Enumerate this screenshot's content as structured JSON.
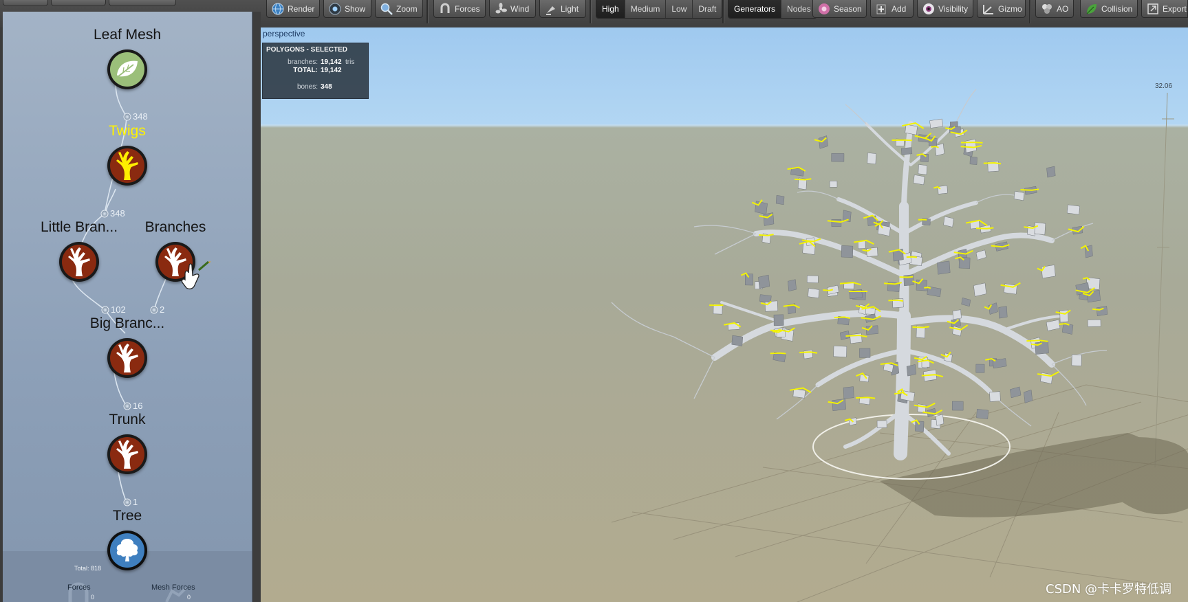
{
  "toolbar": {
    "buttons": [
      {
        "id": "render",
        "label": "Render",
        "icon": "globe-icon"
      },
      {
        "id": "show",
        "label": "Show",
        "icon": "eye-icon"
      },
      {
        "id": "zoom",
        "label": "Zoom",
        "icon": "magnifier-icon"
      },
      {
        "id": "forces",
        "label": "Forces",
        "icon": "magnet-icon"
      },
      {
        "id": "wind",
        "label": "Wind",
        "icon": "fan-icon"
      },
      {
        "id": "light",
        "label": "Light",
        "icon": "lamp-icon"
      }
    ],
    "quality": {
      "options": [
        "High",
        "Medium",
        "Low",
        "Draft"
      ],
      "selected": "High"
    },
    "mode": {
      "options": [
        "Generators",
        "Nodes"
      ],
      "selected": "Generators"
    },
    "buttons2": [
      {
        "id": "season",
        "label": "Season",
        "icon": "season-icon"
      },
      {
        "id": "add",
        "label": "Add",
        "icon": "add-icon"
      },
      {
        "id": "visibility",
        "label": "Visibility",
        "icon": "eyeball-icon"
      },
      {
        "id": "gizmo",
        "label": "Gizmo",
        "icon": "gizmo-icon"
      },
      {
        "id": "ao",
        "label": "AO",
        "icon": "ao-icon"
      },
      {
        "id": "collision",
        "label": "Collision",
        "icon": "leaf-collision-icon"
      },
      {
        "id": "export",
        "label": "Export",
        "icon": "export-icon"
      }
    ]
  },
  "graph": {
    "nodes": [
      {
        "id": "leaf-mesh",
        "title": "Leaf Mesh",
        "icon": "leaf-icon",
        "selected": false
      },
      {
        "id": "twigs",
        "title": "Twigs",
        "icon": "branch-icon",
        "selected": true
      },
      {
        "id": "little-branches",
        "title": "Little Bran...",
        "icon": "branch-icon",
        "selected": false
      },
      {
        "id": "branches",
        "title": "Branches",
        "icon": "branch-icon",
        "selected": false
      },
      {
        "id": "big-branches",
        "title": "Big Branc...",
        "icon": "branch-icon",
        "selected": false
      },
      {
        "id": "trunk",
        "title": "Trunk",
        "icon": "branch-icon",
        "selected": false
      },
      {
        "id": "tree",
        "title": "Tree",
        "icon": "tree-icon",
        "selected": false
      }
    ],
    "port_counts": {
      "leaf_mesh": "348",
      "twigs": "348",
      "little_branches": "102",
      "branches": "2",
      "big_branches": "16",
      "trunk": "1"
    },
    "total": "Total: 818",
    "forces": {
      "label": "Forces",
      "count": "0"
    },
    "mesh_forces": {
      "label": "Mesh Forces",
      "count": "0"
    }
  },
  "viewport": {
    "label": "perspective",
    "stats": {
      "header": "POLYGONS - SELECTED",
      "branches_key": "branches:",
      "branches_value": "19,142",
      "branches_unit": "tris",
      "total_key": "TOTAL:",
      "total_value": "19,142",
      "bones_key": "bones:",
      "bones_value": "348"
    },
    "axis_value": "32.06",
    "watermark": "CSDN @卡卡罗特低调"
  },
  "colors": {
    "selected_node": "#fff200",
    "branch_icon_bg": "#8a2a10",
    "leaf_icon_bg": "#9bbf7a",
    "tree_icon_bg": "#3f7fbf",
    "selection_highlight": "#f3f300"
  }
}
